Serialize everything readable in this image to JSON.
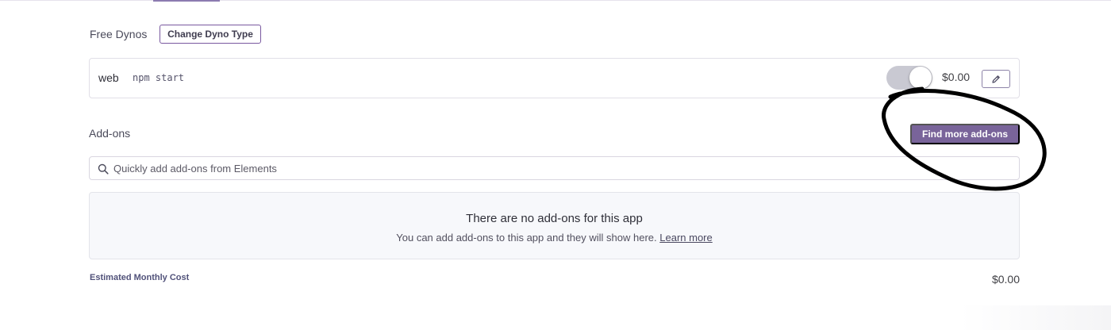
{
  "dyno_section": {
    "label": "Free Dynos",
    "change_button": "Change Dyno Type",
    "dyno": {
      "type": "web",
      "command": "npm start",
      "enabled": true,
      "price": "$0.00"
    }
  },
  "addons_section": {
    "label": "Add-ons",
    "find_button": "Find more add-ons",
    "search_placeholder": "Quickly add add-ons from Elements",
    "empty_title": "There are no add-ons for this app",
    "empty_description": "You can add add-ons to this app and they will show here.",
    "learn_more": "Learn more"
  },
  "cost": {
    "label": "Estimated Monthly Cost",
    "value": "$0.00"
  },
  "colors": {
    "accent": "#79649a",
    "annotation": "#000000"
  }
}
